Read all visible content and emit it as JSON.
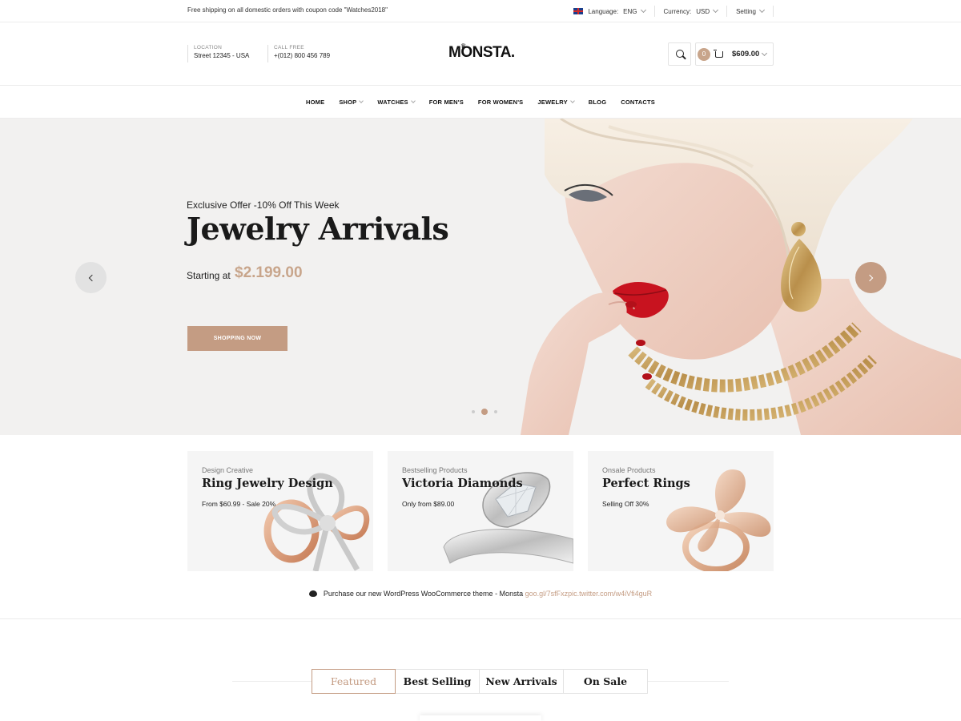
{
  "topbar": {
    "promo": "Free shipping on all domestic orders with coupon code \"Watches2018\"",
    "language_label": "Language:",
    "language_value": "ENG",
    "currency_label": "Currency:",
    "currency_value": "USD",
    "setting_label": "Setting"
  },
  "header": {
    "location_label": "LOCATION",
    "location_value": "Street 12345 - USA",
    "call_label": "CALL FREE",
    "call_value": "+(012) 800 456 789",
    "logo": "MONSTA.",
    "cart_count": "0",
    "cart_total": "$609.00"
  },
  "nav": {
    "items": [
      {
        "label": "HOME",
        "dropdown": false
      },
      {
        "label": "SHOP",
        "dropdown": true
      },
      {
        "label": "WATCHES",
        "dropdown": true
      },
      {
        "label": "FOR MEN'S",
        "dropdown": false
      },
      {
        "label": "FOR WOMEN'S",
        "dropdown": false
      },
      {
        "label": "JEWELRY",
        "dropdown": true
      },
      {
        "label": "BLOG",
        "dropdown": false
      },
      {
        "label": "CONTACTS",
        "dropdown": false
      }
    ]
  },
  "hero": {
    "subtitle": "Exclusive Offer -10% Off This Week",
    "title": "Jewelry Arrivals",
    "price_label": "Starting at",
    "price": "$2.199.00",
    "button": "SHOPPING NOW",
    "slide_count": 3,
    "active_slide": 2
  },
  "cards": [
    {
      "caption": "Design Creative",
      "title": "Ring Jewelry Design",
      "sub": "From  $60.99 - Sale 20%"
    },
    {
      "caption": "Bestselling Products",
      "title": "Victoria Diamonds",
      "sub": "Only  from  $89.00"
    },
    {
      "caption": "Onsale Products",
      "title": "Perfect Rings",
      "sub": "Selling Off  30%"
    }
  ],
  "tweet": {
    "text": "Purchase our new WordPress WooCommerce theme - Monsta",
    "link": "goo.gl/7sfFxzpic.twitter.com/w4iVfi4guR"
  },
  "tabs": [
    {
      "label": "Featured",
      "active": true
    },
    {
      "label": "Best Selling",
      "active": false
    },
    {
      "label": "New Arrivals",
      "active": false
    },
    {
      "label": "On Sale",
      "active": false
    }
  ],
  "colors": {
    "accent": "#c49c83",
    "hero_bg": "#f2f1f0",
    "card_bg": "#f5f5f5"
  }
}
